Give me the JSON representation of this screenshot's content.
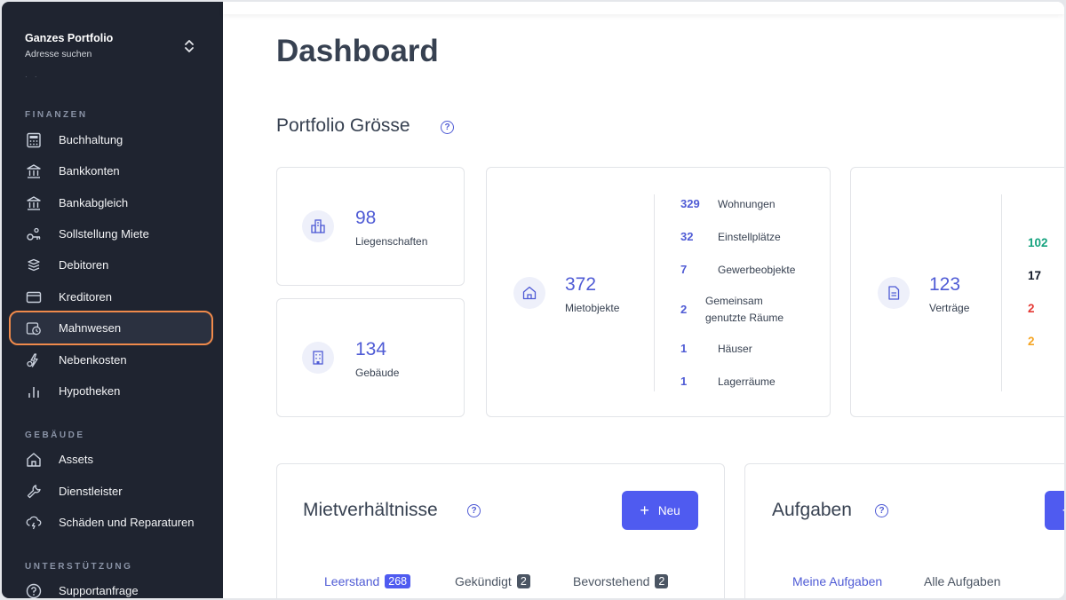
{
  "sidebar": {
    "portfolio_title": "Ganzes Portfolio",
    "portfolio_subtitle": "Adresse suchen",
    "sections": [
      {
        "label": "FINANZEN"
      },
      {
        "label": "GEBÄUDE"
      },
      {
        "label": "UNTERSTÜTZUNG"
      }
    ],
    "items": [
      {
        "label": "Buchhaltung",
        "icon": "calculator-icon"
      },
      {
        "label": "Bankkonten",
        "icon": "bank-icon"
      },
      {
        "label": "Bankabgleich",
        "icon": "bank-icon"
      },
      {
        "label": "Sollstellung Miete",
        "icon": "rent-icon"
      },
      {
        "label": "Debitoren",
        "icon": "coins-icon"
      },
      {
        "label": "Kreditoren",
        "icon": "credit-card-icon"
      },
      {
        "label": "Mahnwesen",
        "icon": "reminder-icon",
        "active": true
      },
      {
        "label": "Nebenkosten",
        "icon": "utilities-icon"
      },
      {
        "label": "Hypotheken",
        "icon": "bar-chart-icon"
      },
      {
        "label": "Assets",
        "icon": "home-icon"
      },
      {
        "label": "Dienstleister",
        "icon": "wrench-icon"
      },
      {
        "label": "Schäden und Reparaturen",
        "icon": "storm-cloud-icon"
      },
      {
        "label": "Supportanfrage",
        "icon": "help-circle-icon"
      }
    ]
  },
  "main": {
    "page_title": "Dashboard",
    "portfolio_section_title": "Portfolio Grösse",
    "liegenschaften": {
      "value": "98",
      "label": "Liegenschaften"
    },
    "gebaeude": {
      "value": "134",
      "label": "Gebäude"
    },
    "mietobjekte": {
      "value": "372",
      "label": "Mietobjekte",
      "breakdown": [
        {
          "value": "329",
          "label": "Wohnungen"
        },
        {
          "value": "32",
          "label": "Einstellplätze"
        },
        {
          "value": "7",
          "label": "Gewerbeobjekte"
        },
        {
          "value": "2",
          "label": "Gemeinsam genutzte Räume"
        },
        {
          "value": "1",
          "label": "Häuser"
        },
        {
          "value": "1",
          "label": "Lagerräume"
        }
      ]
    },
    "vertraege": {
      "value": "123",
      "label": "Verträge",
      "counts": [
        {
          "value": "102",
          "color": "#16a37f"
        },
        {
          "value": "17",
          "color": "#111827"
        },
        {
          "value": "2",
          "color": "#e53935"
        },
        {
          "value": "2",
          "color": "#f5a524"
        }
      ]
    },
    "mietverhaeltnisse": {
      "title": "Mietverhältnisse",
      "new_button": "Neu",
      "tabs": [
        {
          "label": "Leerstand",
          "count": "268",
          "active": true
        },
        {
          "label": "Gekündigt",
          "count": "2"
        },
        {
          "label": "Bevorstehend",
          "count": "2"
        }
      ]
    },
    "aufgaben": {
      "title": "Aufgaben",
      "tabs": [
        {
          "label": "Meine Aufgaben",
          "active": true
        },
        {
          "label": "Alle Aufgaben"
        }
      ]
    }
  },
  "colors": {
    "accent": "#4f5bd5",
    "button": "#4f5bf0",
    "sidebar_bg": "#1f2430",
    "active_outline": "#f08a4b"
  }
}
